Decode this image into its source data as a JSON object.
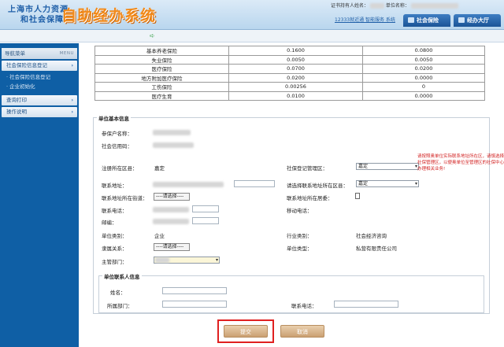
{
  "header": {
    "logo_line1": "上海市人力资源",
    "logo_line2": "和社会保障",
    "app_title": "自助经办系统",
    "user_label": "证书持有人姓名：",
    "unit_label": "单位名称：",
    "top_link": "12333就近通 智能服务 系统",
    "tabs": [
      {
        "label": "社会保险"
      },
      {
        "label": "经办大厅"
      }
    ]
  },
  "sidebar": {
    "header": "导航菜单",
    "header_en": "MENU",
    "items": [
      {
        "label": "社会保险信息登记",
        "chevron": "›"
      },
      {
        "label": "查询打印",
        "chevron": "›"
      },
      {
        "label": "操作说明",
        "chevron": "›"
      }
    ],
    "sub_items": [
      {
        "label": "· 社会保险信息登记"
      },
      {
        "label": "· 企业初始化"
      }
    ]
  },
  "rates": [
    {
      "name": "基本养老保险",
      "rate1": "0.1600",
      "rate2": "0.0800"
    },
    {
      "name": "失业保险",
      "rate1": "0.0050",
      "rate2": "0.0050"
    },
    {
      "name": "医疗保险",
      "rate1": "0.0700",
      "rate2": "0.0200"
    },
    {
      "name": "地方附加医疗保险",
      "rate1": "0.0200",
      "rate2": "0.0000"
    },
    {
      "name": "工伤保险",
      "rate1": "0.00256",
      "rate2": "0"
    },
    {
      "name": "医疗生育",
      "rate1": "0.0100",
      "rate2": "0.0000"
    }
  ],
  "unit_info": {
    "section_title": "单位基本信息",
    "insured_name_label": "参保户名称：",
    "credit_code_label": "社会信用码：",
    "reg_district_label": "注册所在区县：",
    "reg_district_value": "嘉定",
    "si_district_label": "社保登记管理区：",
    "si_district_value": "嘉定",
    "address_label": "联系地址：",
    "address_district_label": "请选择联系地址所在区县：",
    "address_district_value": "嘉定",
    "street_label": "联系地址所在街道：",
    "street_value": "----请选择----",
    "same_as_label": "联系地址所在居委：",
    "phone_label": "联系电话：",
    "mobile_label": "移动电话：",
    "postcode_label": "邮编：",
    "unit_type_label": "单位类别：",
    "unit_type_value": "企业",
    "industry_label": "行业类别：",
    "industry_value": "社会经济咨询",
    "affiliation_label": "隶属关系：",
    "affiliation_value": "----请选择----",
    "entity_type_label": "单位类型：",
    "entity_type_value": "私营有限责任公司",
    "dept_label": "主管部门：",
    "warning": "请按照奥单位实际联系地址所在区，请慎选择社保管理区，以便奥单位至管理区的社保中心办理相关业务!"
  },
  "contact_info": {
    "section_title": "单位联系人信息",
    "name_label": "姓名：",
    "dept_label": "所属部门：",
    "phone_label": "联系电话："
  },
  "actions": {
    "submit": "提交",
    "cancel": "取消"
  },
  "colors": {
    "sidebar": "#0f5fa5",
    "accent": "#f28a1a",
    "highlight": "#e02020",
    "warning": "#d21f1f"
  }
}
